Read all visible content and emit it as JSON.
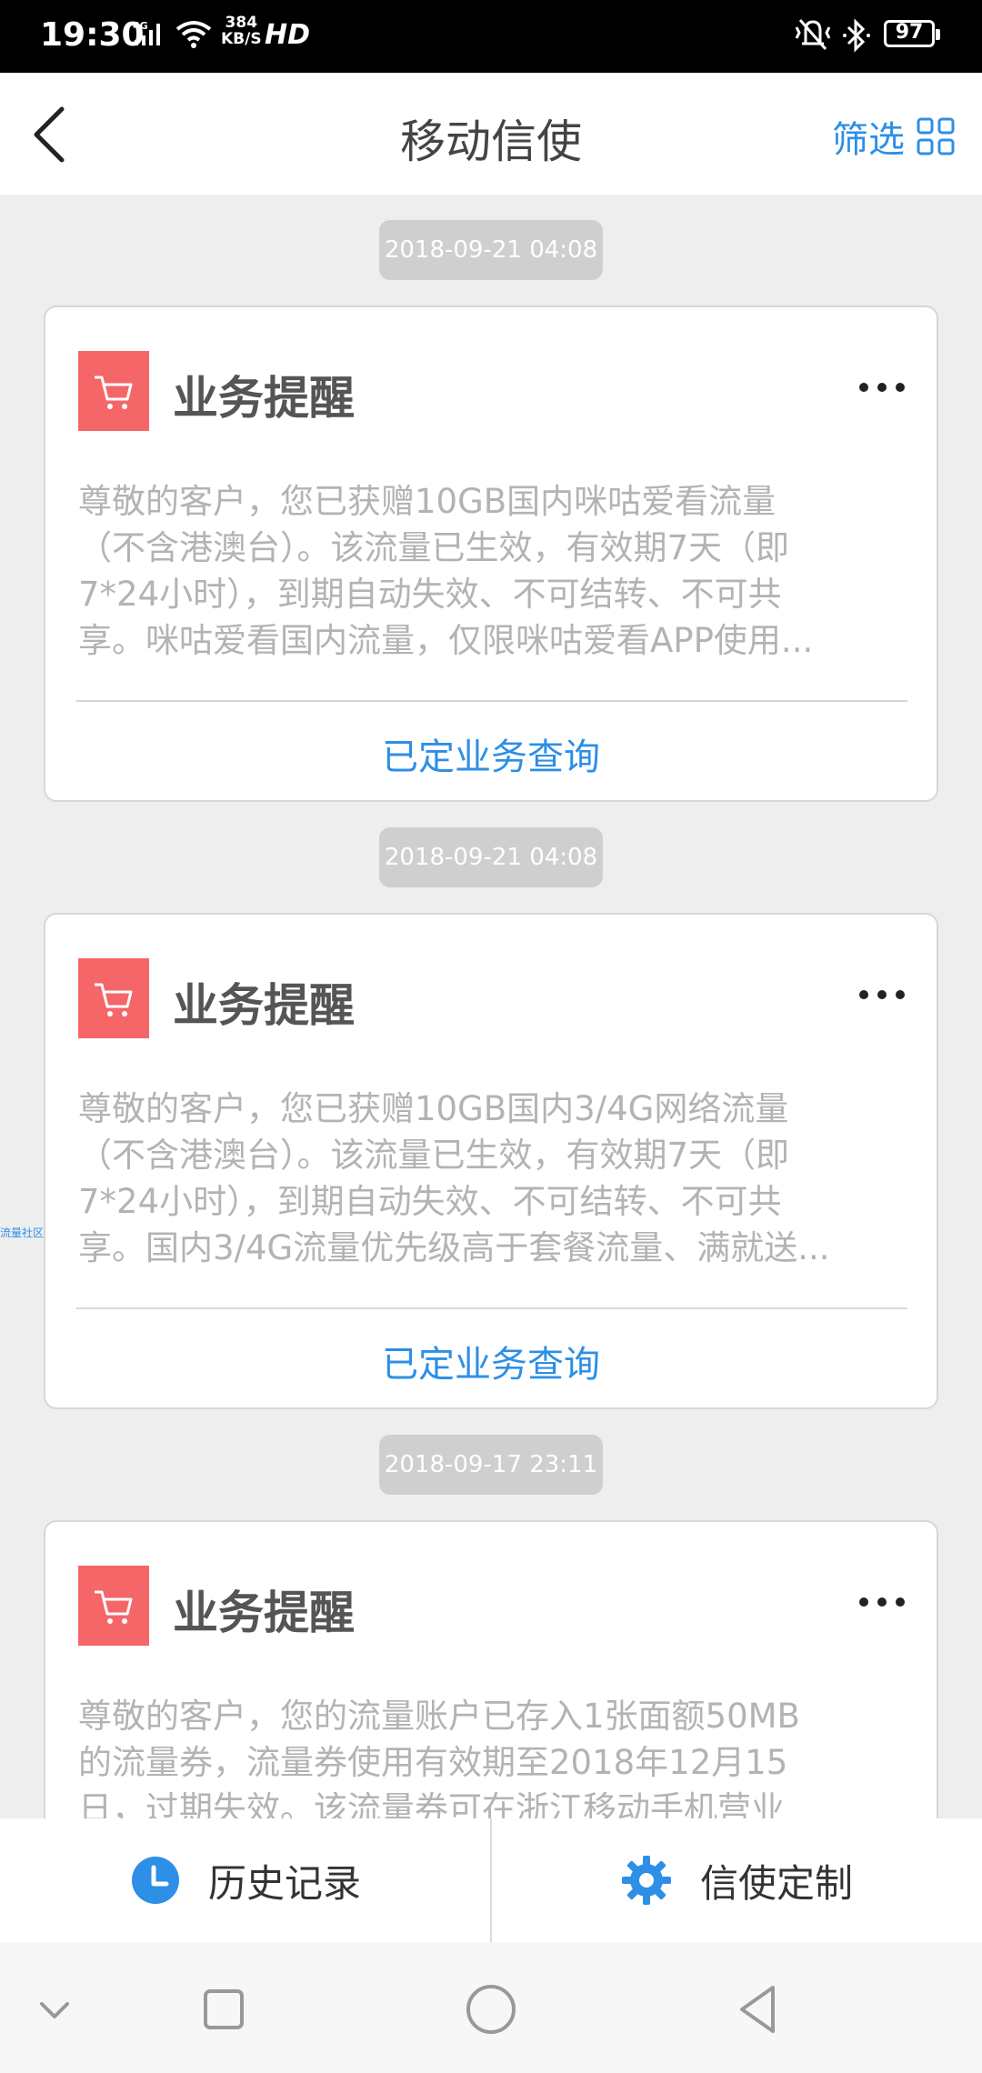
{
  "status_bar": {
    "time": "19:30",
    "net_type": "4G",
    "speed_value": "384",
    "speed_unit": "KB/S",
    "hd": "HD",
    "battery": "97"
  },
  "header": {
    "title": "移动信使",
    "filter_label": "筛选"
  },
  "side_tag": "流量社区",
  "messages": [
    {
      "timestamp": "2018-09-21 04:08",
      "title": "业务提醒",
      "body_lines": [
        "尊敬的客户，您已获赠10GB国内咪咕爱看流量",
        "（不含港澳台）。该流量已生效，有效期7天（即",
        "7*24小时），到期自动失效、不可结转、不可共",
        "享。咪咕爱看国内流量，仅限咪咕爱看APP使用..."
      ],
      "action": "已定业务查询"
    },
    {
      "timestamp": "2018-09-21 04:08",
      "title": "业务提醒",
      "body_lines": [
        "尊敬的客户，您已获赠10GB国内3/4G网络流量",
        "（不含港澳台）。该流量已生效，有效期7天（即",
        "7*24小时），到期自动失效、不可结转、不可共",
        "享。国内3/4G流量优先级高于套餐流量、满就送..."
      ],
      "action": "已定业务查询"
    },
    {
      "timestamp": "2018-09-17 23:11",
      "title": "业务提醒",
      "body_lines": [
        "尊敬的客户，您的流量账户已存入1张面额50MB",
        "的流量券，流量券使用有效期至2018年12月15",
        "日，过期失效。该流量券可在浙江移动手机营业"
      ],
      "action": ""
    }
  ],
  "bottom_tabs": {
    "history": "历史记录",
    "customize": "信使定制"
  },
  "colors": {
    "accent": "#2d8fe6",
    "icon_red": "#f56668"
  }
}
